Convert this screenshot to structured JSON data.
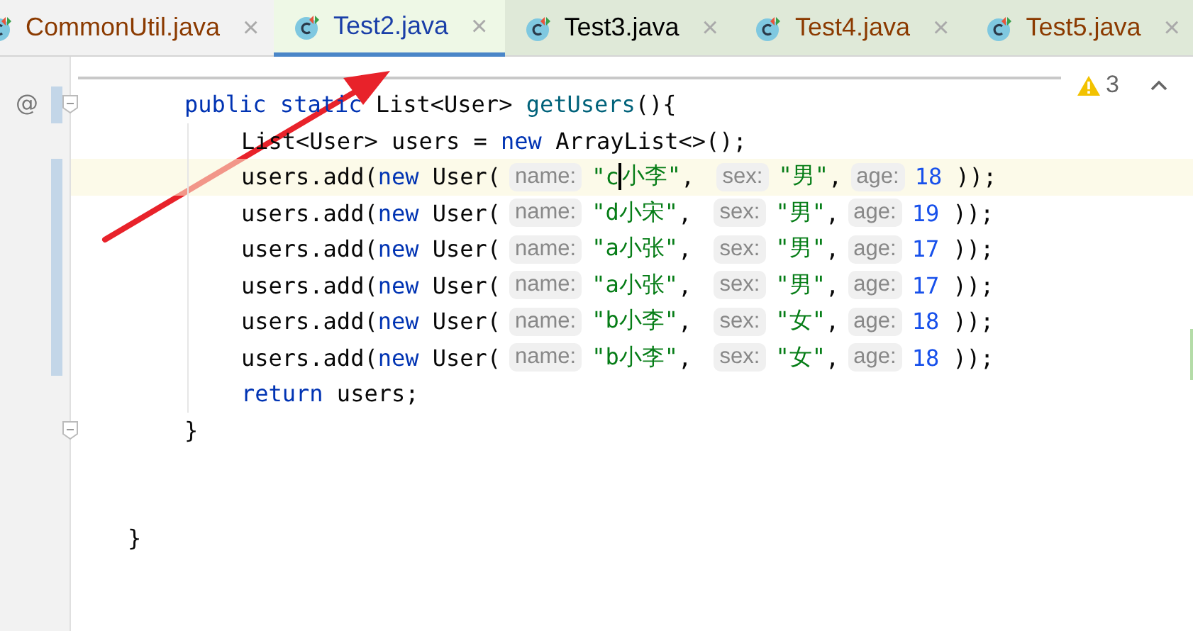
{
  "tabs": [
    {
      "label": "CommonUtil.java",
      "selected": false,
      "tinted": false,
      "color": "#8b3a00"
    },
    {
      "label": "Test2.java",
      "selected": true,
      "tinted": true,
      "color": "#1a3fa8"
    },
    {
      "label": "Test3.java",
      "selected": false,
      "tinted": true,
      "color": "#000000"
    },
    {
      "label": "Test4.java",
      "selected": false,
      "tinted": true,
      "color": "#8b3a00"
    },
    {
      "label": "Test5.java",
      "selected": false,
      "tinted": true,
      "color": "#8b3a00"
    }
  ],
  "close_glyph": "×",
  "inspections": {
    "count": "3"
  },
  "gutter_mark": "@",
  "lines": [
    {
      "kind": "block",
      "children": [
        {
          "kind": "line",
          "current": false,
          "changed": true,
          "fold": true,
          "annotated": true,
          "tokens": [
            {
              "kind": "keyword",
              "text": "public static"
            },
            {
              "kind": "plain",
              "text": " List<User> "
            },
            {
              "kind": "method",
              "text": "getUsers"
            },
            {
              "kind": "plain",
              "text": "(){"
            }
          ],
          "children": [
            {
              "kind": "line",
              "current": false,
              "changed": false,
              "fold": false,
              "annotated": false,
              "tokens": [
                {
                  "kind": "plain",
                  "text": "List<User> users = "
                },
                {
                  "kind": "keyword",
                  "text": "new"
                },
                {
                  "kind": "plain",
                  "text": " ArrayList<>();"
                }
              ]
            },
            {
              "kind": "line",
              "current": true,
              "changed": true,
              "fold": false,
              "annotated": false,
              "tokens": [
                {
                  "kind": "plain",
                  "text": "users.add("
                },
                {
                  "kind": "keyword",
                  "text": "new"
                },
                {
                  "kind": "plain",
                  "text": " User("
                },
                {
                  "kind": "hint",
                  "text": "name:"
                },
                {
                  "kind": "string",
                  "text": "\"c"
                },
                {
                  "kind": "caret"
                },
                {
                  "kind": "string",
                  "text": "小李\""
                },
                {
                  "kind": "plain",
                  "text": ", "
                },
                {
                  "kind": "hint",
                  "text": "sex:"
                },
                {
                  "kind": "string",
                  "text": "\"男\""
                },
                {
                  "kind": "plain",
                  "text": ","
                },
                {
                  "kind": "hint",
                  "text": "age:"
                },
                {
                  "kind": "number",
                  "text": "18"
                },
                {
                  "kind": "plain",
                  "text": " ));"
                }
              ]
            },
            {
              "kind": "line",
              "current": false,
              "changed": true,
              "fold": false,
              "annotated": false,
              "tokens": [
                {
                  "kind": "plain",
                  "text": "users.add("
                },
                {
                  "kind": "keyword",
                  "text": "new"
                },
                {
                  "kind": "plain",
                  "text": " User("
                },
                {
                  "kind": "hint",
                  "text": "name:"
                },
                {
                  "kind": "string",
                  "text": "\"d小宋\""
                },
                {
                  "kind": "plain",
                  "text": ", "
                },
                {
                  "kind": "hint",
                  "text": "sex:"
                },
                {
                  "kind": "string",
                  "text": "\"男\""
                },
                {
                  "kind": "plain",
                  "text": ","
                },
                {
                  "kind": "hint",
                  "text": "age:"
                },
                {
                  "kind": "number",
                  "text": "19"
                },
                {
                  "kind": "plain",
                  "text": " ));"
                }
              ]
            },
            {
              "kind": "line",
              "current": false,
              "changed": true,
              "fold": false,
              "annotated": false,
              "tokens": [
                {
                  "kind": "plain",
                  "text": "users.add("
                },
                {
                  "kind": "keyword",
                  "text": "new"
                },
                {
                  "kind": "plain",
                  "text": " User("
                },
                {
                  "kind": "hint",
                  "text": "name:"
                },
                {
                  "kind": "string",
                  "text": "\"a小张\""
                },
                {
                  "kind": "plain",
                  "text": ", "
                },
                {
                  "kind": "hint",
                  "text": "sex:"
                },
                {
                  "kind": "string",
                  "text": "\"男\""
                },
                {
                  "kind": "plain",
                  "text": ","
                },
                {
                  "kind": "hint",
                  "text": "age:"
                },
                {
                  "kind": "number",
                  "text": "17"
                },
                {
                  "kind": "plain",
                  "text": " ));"
                }
              ]
            },
            {
              "kind": "line",
              "current": false,
              "changed": true,
              "fold": false,
              "annotated": false,
              "tokens": [
                {
                  "kind": "plain",
                  "text": "users.add("
                },
                {
                  "kind": "keyword",
                  "text": "new"
                },
                {
                  "kind": "plain",
                  "text": " User("
                },
                {
                  "kind": "hint",
                  "text": "name:"
                },
                {
                  "kind": "string",
                  "text": "\"a小张\""
                },
                {
                  "kind": "plain",
                  "text": ", "
                },
                {
                  "kind": "hint",
                  "text": "sex:"
                },
                {
                  "kind": "string",
                  "text": "\"男\""
                },
                {
                  "kind": "plain",
                  "text": ","
                },
                {
                  "kind": "hint",
                  "text": "age:"
                },
                {
                  "kind": "number",
                  "text": "17"
                },
                {
                  "kind": "plain",
                  "text": " ));"
                }
              ]
            },
            {
              "kind": "line",
              "current": false,
              "changed": true,
              "fold": false,
              "annotated": false,
              "tokens": [
                {
                  "kind": "plain",
                  "text": "users.add("
                },
                {
                  "kind": "keyword",
                  "text": "new"
                },
                {
                  "kind": "plain",
                  "text": " User("
                },
                {
                  "kind": "hint",
                  "text": "name:"
                },
                {
                  "kind": "string",
                  "text": "\"b小李\""
                },
                {
                  "kind": "plain",
                  "text": ", "
                },
                {
                  "kind": "hint",
                  "text": "sex:"
                },
                {
                  "kind": "string",
                  "text": "\"女\""
                },
                {
                  "kind": "plain",
                  "text": ","
                },
                {
                  "kind": "hint",
                  "text": "age:"
                },
                {
                  "kind": "number",
                  "text": "18"
                },
                {
                  "kind": "plain",
                  "text": " ));"
                }
              ]
            },
            {
              "kind": "line",
              "current": false,
              "changed": true,
              "fold": false,
              "annotated": false,
              "tokens": [
                {
                  "kind": "plain",
                  "text": "users.add("
                },
                {
                  "kind": "keyword",
                  "text": "new"
                },
                {
                  "kind": "plain",
                  "text": " User("
                },
                {
                  "kind": "hint",
                  "text": "name:"
                },
                {
                  "kind": "string",
                  "text": "\"b小李\""
                },
                {
                  "kind": "plain",
                  "text": ", "
                },
                {
                  "kind": "hint",
                  "text": "sex:"
                },
                {
                  "kind": "string",
                  "text": "\"女\""
                },
                {
                  "kind": "plain",
                  "text": ","
                },
                {
                  "kind": "hint",
                  "text": "age:"
                },
                {
                  "kind": "number",
                  "text": "18"
                },
                {
                  "kind": "plain",
                  "text": " ));"
                }
              ]
            },
            {
              "kind": "line",
              "current": false,
              "changed": false,
              "fold": false,
              "annotated": false,
              "tokens": [
                {
                  "kind": "keyword",
                  "text": "return"
                },
                {
                  "kind": "plain",
                  "text": " users;"
                }
              ]
            }
          ]
        },
        {
          "kind": "line",
          "current": false,
          "changed": false,
          "fold": true,
          "annotated": false,
          "tokens": [
            {
              "kind": "plain",
              "text": "}"
            }
          ]
        }
      ]
    },
    {
      "kind": "blank"
    },
    {
      "kind": "blank"
    },
    {
      "kind": "line",
      "current": false,
      "changed": false,
      "fold": false,
      "annotated": false,
      "tokens": [
        {
          "kind": "plain",
          "text": "}"
        }
      ]
    }
  ]
}
